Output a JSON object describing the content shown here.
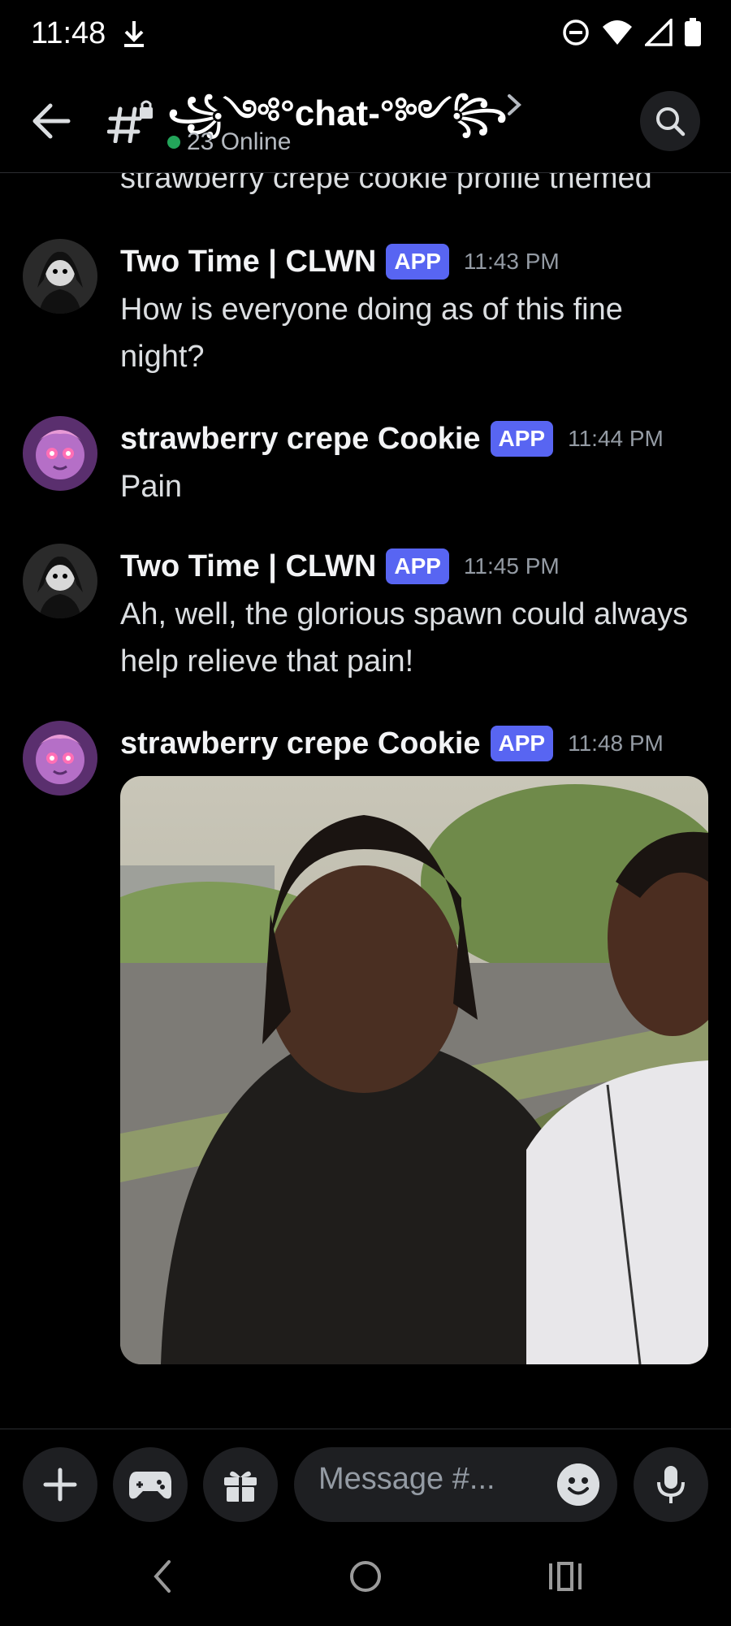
{
  "status_bar": {
    "time": "11:48"
  },
  "header": {
    "channel_name": "꧁༺°chat-°༻꧂",
    "online_text": "23 Online"
  },
  "messages": {
    "truncated_text": "strawberry crepe cookie profile themed",
    "items": [
      {
        "author": "Two Time | CLWN",
        "badge": "APP",
        "time": "11:43 PM",
        "text": "How is everyone doing as of this fine night?"
      },
      {
        "author": "strawberry crepe Cookie",
        "badge": "APP",
        "time": "11:44 PM",
        "text": "Pain"
      },
      {
        "author": "Two Time | CLWN",
        "badge": "APP",
        "time": "11:45 PM",
        "text": "Ah, well, the glorious spawn could always help relieve that pain!"
      },
      {
        "author": "strawberry crepe Cookie",
        "badge": "APP",
        "time": "11:48 PM",
        "text": ""
      }
    ]
  },
  "composer": {
    "placeholder": "Message #..."
  },
  "colors": {
    "accent": "#5865f2",
    "online": "#23a55a",
    "background": "#000000"
  },
  "icons": [
    "download-icon",
    "dnd-icon",
    "wifi-icon",
    "signal-icon",
    "battery-icon",
    "back-arrow-icon",
    "locked-channel-icon",
    "chevron-right-icon",
    "search-icon",
    "plus-icon",
    "gamepad-icon",
    "gift-icon",
    "emoji-icon",
    "microphone-icon",
    "nav-back-icon",
    "nav-home-icon",
    "nav-recents-icon"
  ]
}
